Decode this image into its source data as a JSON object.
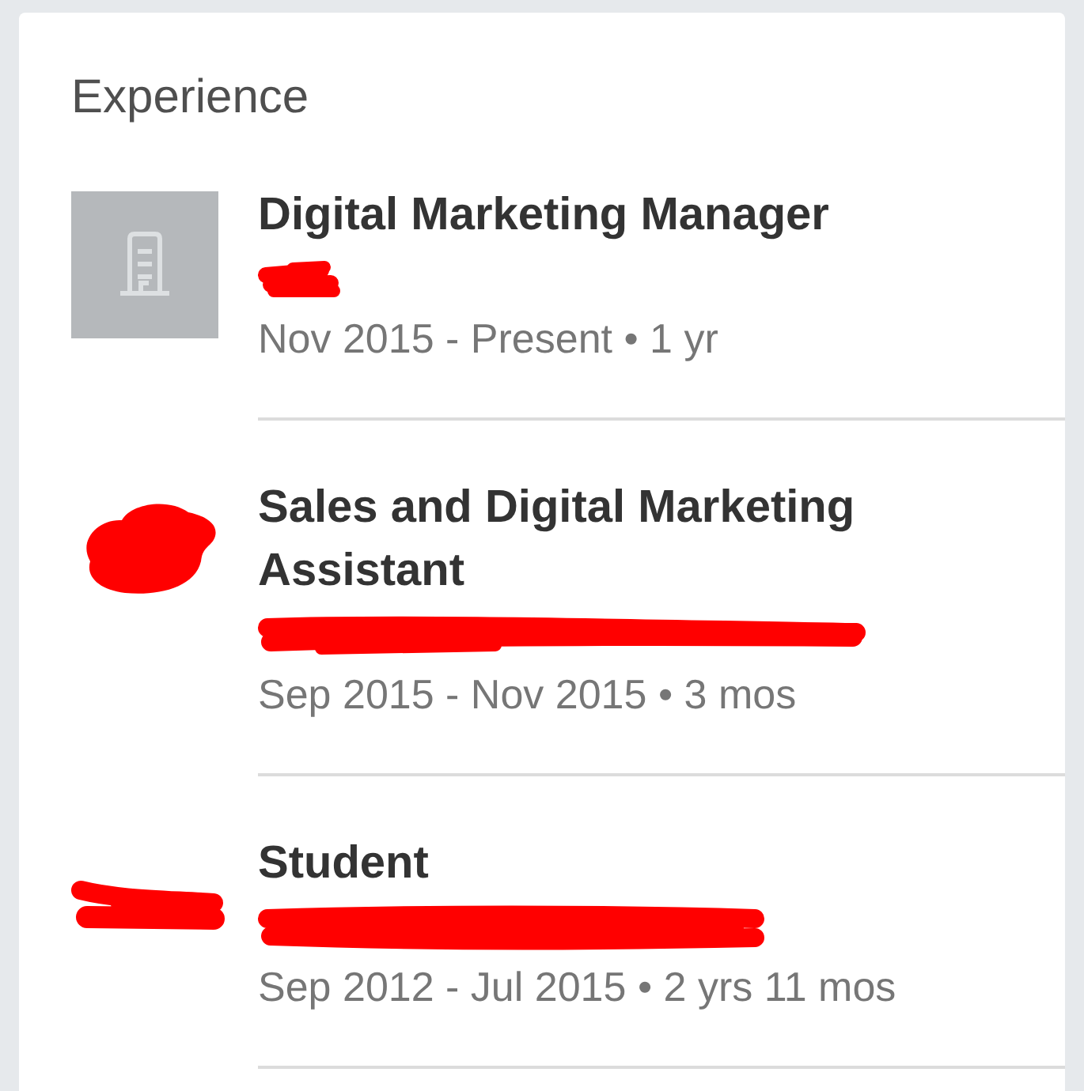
{
  "section": {
    "title": "Experience"
  },
  "positions": [
    {
      "title": "Digital Marketing Manager",
      "logo": {
        "kind": "building-placeholder"
      },
      "company_redacted": true,
      "date_range": "Nov 2015 - Present • 1 yr"
    },
    {
      "title": "Sales and Digital Marketing Assistant",
      "logo": {
        "kind": "redaction-blob"
      },
      "company_redacted": true,
      "date_range": "Sep 2015 - Nov 2015 • 3 mos"
    },
    {
      "title": "Student",
      "logo": {
        "kind": "redaction-streak"
      },
      "company_redacted": true,
      "date_range": "Sep 2012 - Jul 2015 • 2 yrs 11 mos"
    }
  ]
}
